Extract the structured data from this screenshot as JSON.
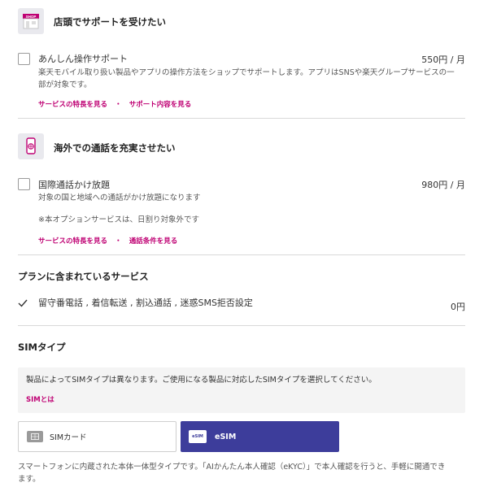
{
  "support": {
    "shop_icon_text": "SHOP",
    "title": "店頭でサポートを受けたい",
    "option_name": "あんしん操作サポート",
    "price": "550円 / 月",
    "desc_line1": "楽天モバイル取り扱い製品やアプリの操作方法をショップでサポートします。アプリはSNSや楽天グループサービスの一",
    "desc_line2": "部が対象です。",
    "link_features": "サービスの特長を見る",
    "link_sep": "・",
    "link_content": "サポート内容を見る"
  },
  "overseas": {
    "title": "海外での通話を充実させたい",
    "option_name": "国際通話かけ放題",
    "price": "980円 / 月",
    "desc": "対象の国と地域への通話がかけ放題になります",
    "note": "※本オプションサービスは、日割り対象外です",
    "link_features": "サービスの特長を見る",
    "link_sep": "・",
    "link_conditions": "通話条件を見る"
  },
  "included": {
    "title": "プランに含まれているサービス",
    "services": "留守番電話 , 着信転送 , 割込通話 , 迷惑SMS拒否設定",
    "price": "0円"
  },
  "sim": {
    "title": "SIMタイプ",
    "info_text": "製品によってSIMタイプは異なります。ご使用になる製品に対応したSIMタイプを選択してください。",
    "info_link": "SIMとは",
    "option_card": "SIMカード",
    "option_esim": "eSIM",
    "esim_icon_text": "eSIM",
    "footer_line1": "スマートフォンに内蔵された本体一体型タイプです。「AIかんたん本人確認（eKYC）」で本人確認を行うと、手軽に開通でき",
    "footer_line2": "ます。",
    "accent": "#3d3d9b"
  },
  "colors": {
    "link": "#bf0073",
    "brand": "#bf0073"
  }
}
